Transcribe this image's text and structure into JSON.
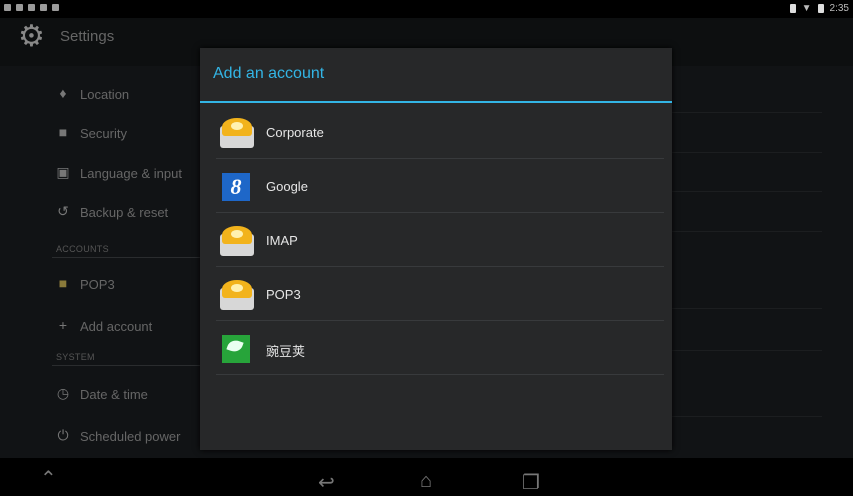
{
  "status_bar": {
    "time": "2:35"
  },
  "settings": {
    "title": "Settings",
    "items": [
      {
        "label": "Location",
        "icon": "location-pin-icon"
      },
      {
        "label": "Security",
        "icon": "lock-icon"
      },
      {
        "label": "Language & input",
        "icon": "keyboard-icon"
      },
      {
        "label": "Backup & reset",
        "icon": "restore-icon"
      }
    ],
    "accounts_header": "ACCOUNTS",
    "accounts": [
      {
        "label": "POP3",
        "icon": "pop3-briefcase-icon"
      }
    ],
    "add_account": "Add account",
    "system_header": "SYSTEM",
    "system_items": [
      {
        "label": "Date & time",
        "icon": "clock-icon"
      },
      {
        "label": "Scheduled power",
        "icon": "power-icon"
      }
    ]
  },
  "dialog": {
    "title": "Add an account",
    "options": [
      {
        "label": "Corporate",
        "icon": "mail-envelope-icon"
      },
      {
        "label": "Google",
        "icon": "google-icon"
      },
      {
        "label": "IMAP",
        "icon": "mail-envelope-icon"
      },
      {
        "label": "POP3",
        "icon": "mail-envelope-icon"
      },
      {
        "label": "豌豆荚",
        "icon": "wandoujia-icon"
      }
    ]
  },
  "colors": {
    "accent": "#33b5e5",
    "dialog_bg": "#272829",
    "background": "#111315"
  }
}
